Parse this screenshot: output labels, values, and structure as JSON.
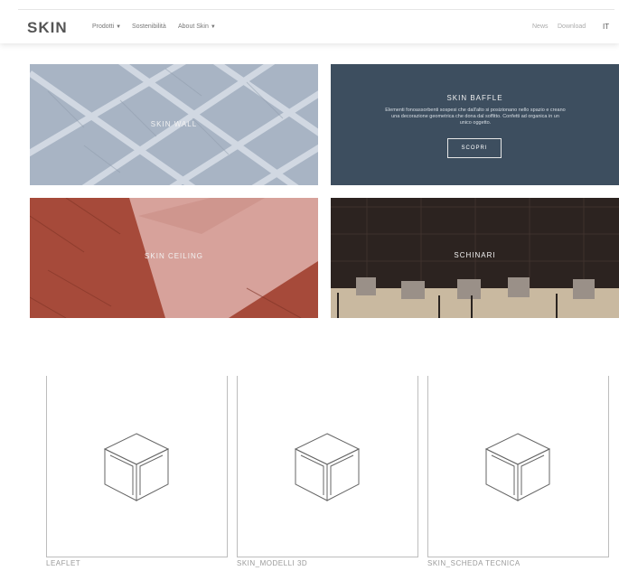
{
  "header": {
    "logo": "SKIN",
    "nav": [
      {
        "label": "Prodotti",
        "caret": "▼"
      },
      {
        "label": "Sostenibilità",
        "caret": ""
      },
      {
        "label": "About Skin",
        "caret": "▼"
      }
    ],
    "news": "News",
    "download": "Download",
    "lang": "IT"
  },
  "tiles": {
    "skin_wall": {
      "label": "SKIN WALL"
    },
    "skin_baffle": {
      "title": "SKIN BAFFLE",
      "description": "Elementi fonoassorbenti sospesi che dall'alto si posizionano nello spazio e creano una decorazione geometrica che dona dal soffitto. Confetti ad organica in un unico oggetto.",
      "cta": "SCOPRI"
    },
    "skin_ceiling": {
      "label": "SKIN CEILING"
    },
    "schinari": {
      "label": "SCHINARI"
    }
  },
  "downloads": [
    {
      "caption": "LEAFLET"
    },
    {
      "caption": "SKIN_MODELLI 3D"
    },
    {
      "caption": "SKIN_SCHEDA TECNICA"
    }
  ],
  "colors": {
    "wall_tile": "#a8b4c4",
    "baffle_tile": "#3d4e5f",
    "ceiling_tile": "#a64a3a",
    "schinari_tile": "#2c2320"
  }
}
